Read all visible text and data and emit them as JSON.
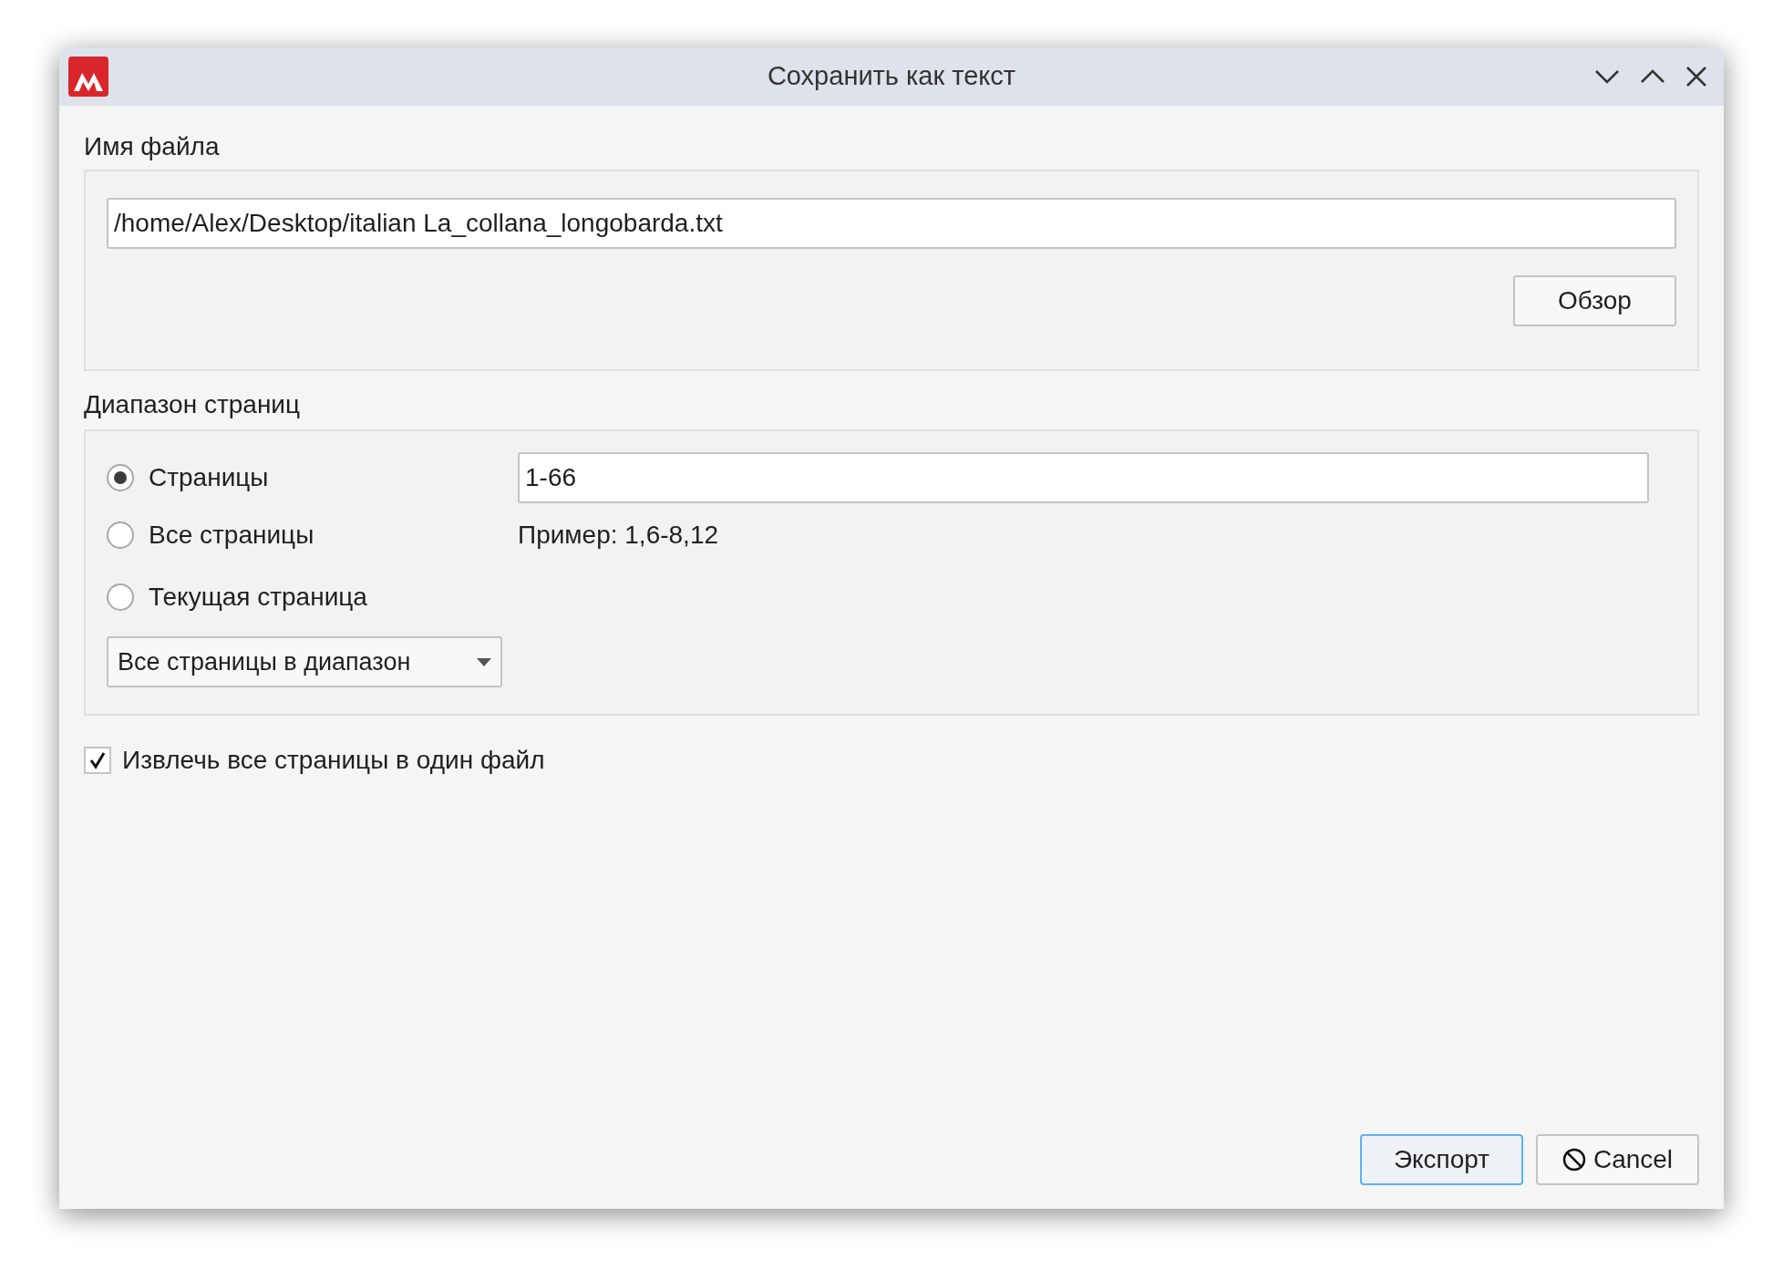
{
  "window": {
    "title": "Сохранить как текст"
  },
  "file_name": {
    "label": "Имя файла",
    "value": "/home/Alex/Desktop/italian La_collana_longobarda.txt",
    "browse_button": "Обзор"
  },
  "page_range": {
    "label": "Диапазон страниц",
    "options": [
      {
        "label": "Страницы",
        "selected": true
      },
      {
        "label": "Все страницы",
        "selected": false
      },
      {
        "label": "Текущая страница",
        "selected": false
      }
    ],
    "pages_value": "1-66",
    "example": "Пример: 1,6-8,12",
    "subset_dropdown": "Все страницы в диапазон"
  },
  "single_file": {
    "label": "Извлечь все страницы в один файл",
    "checked": true
  },
  "buttons": [
    {
      "label": "Экспорт",
      "kind": "default"
    },
    {
      "label": "Cancel",
      "kind": "cancel"
    }
  ]
}
